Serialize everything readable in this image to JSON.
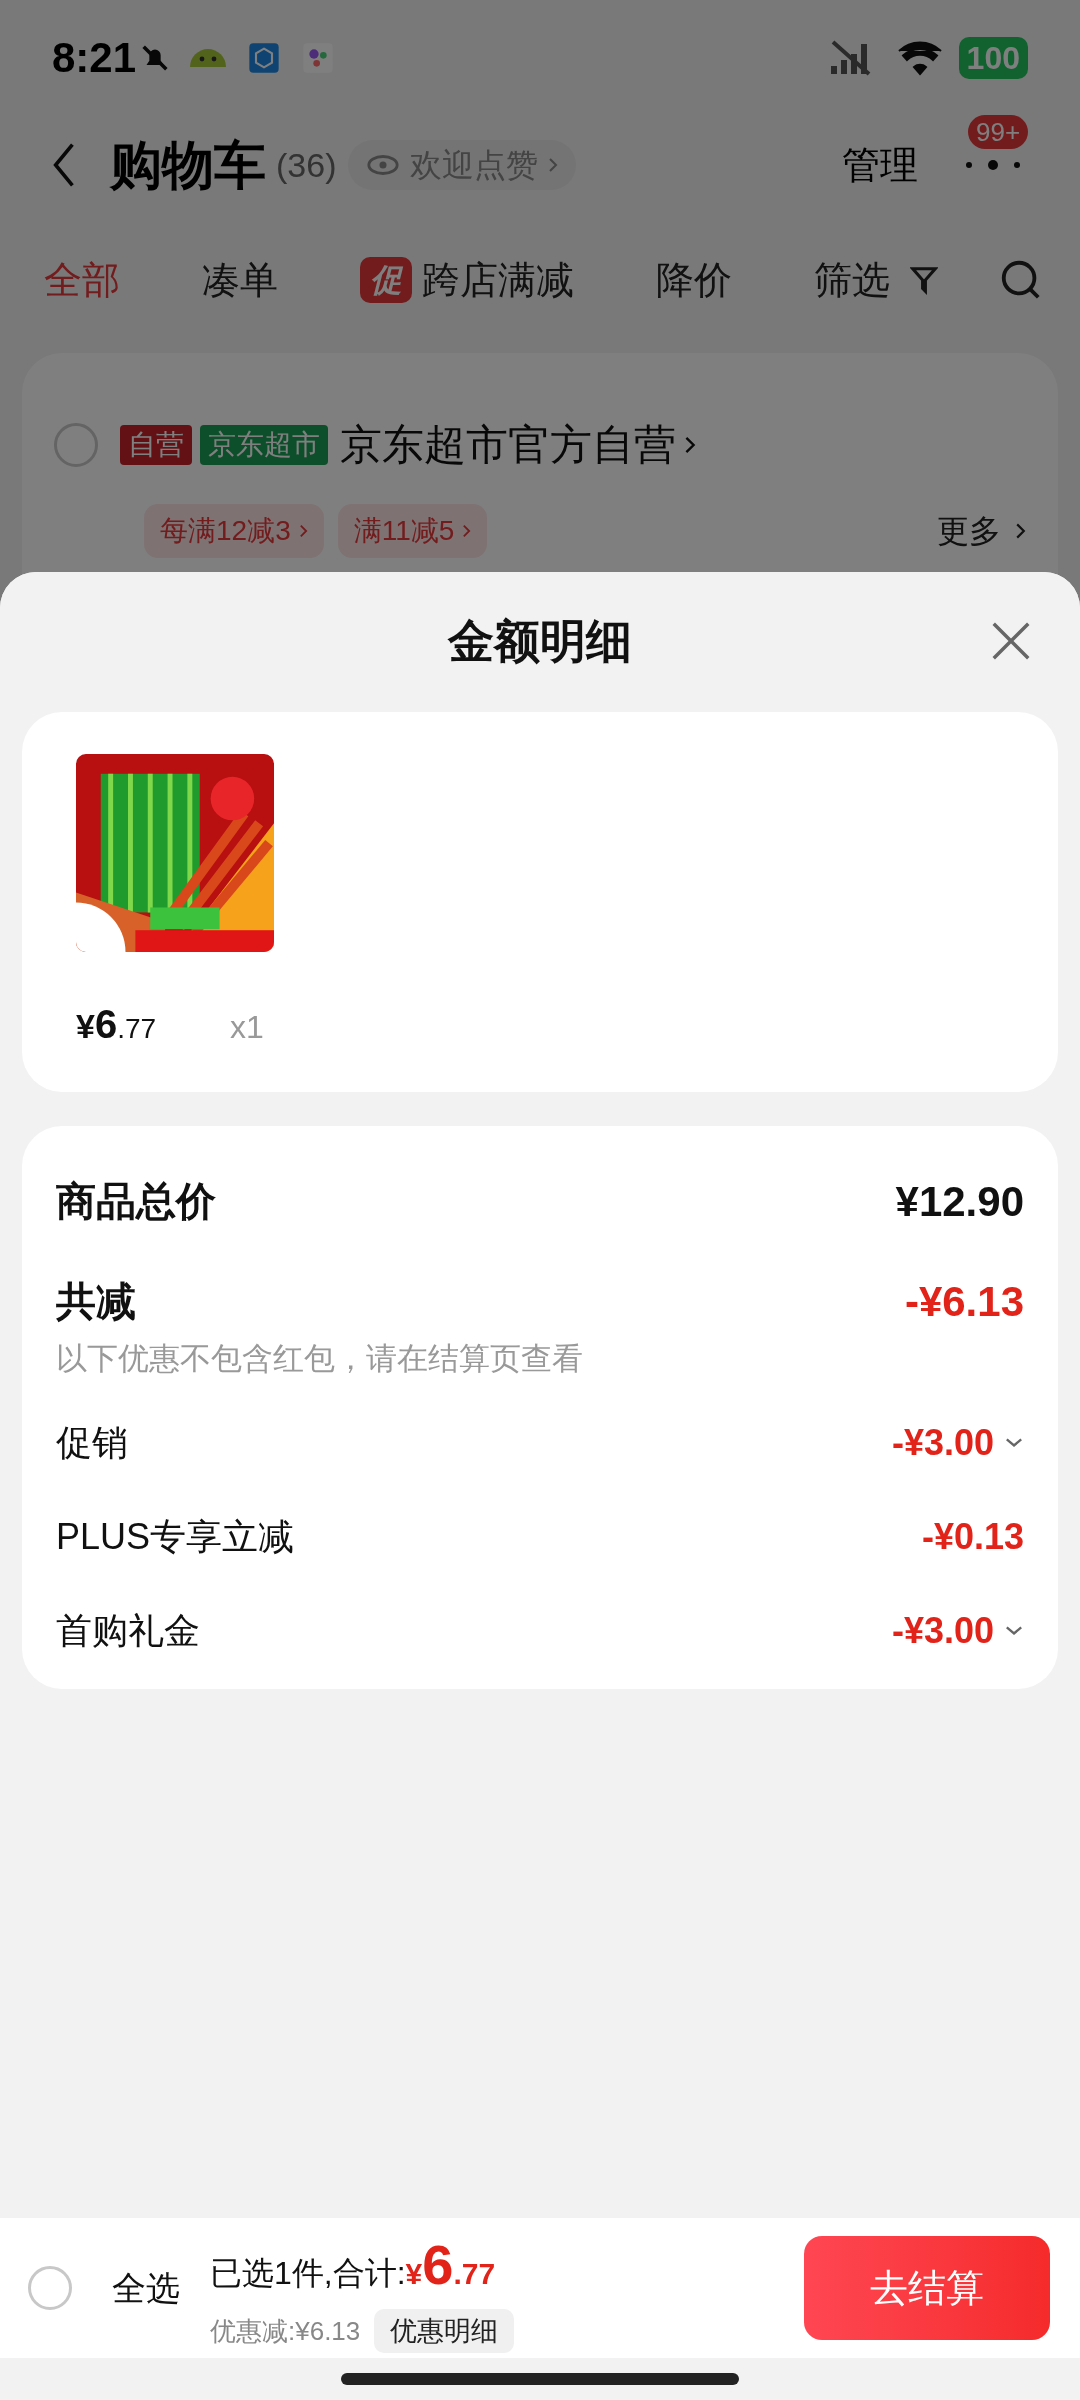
{
  "status_bar": {
    "time": "8:21",
    "battery": "100"
  },
  "header": {
    "title": "购物车",
    "count": "(36)",
    "like_chip": "欢迎点赞",
    "manage": "管理",
    "badge": "99+"
  },
  "tabs": [
    {
      "kind": "plain",
      "label": "全部",
      "selected": true
    },
    {
      "kind": "plain",
      "label": "凑单",
      "selected": false
    },
    {
      "kind": "promo",
      "tag": "促",
      "label": "跨店满减",
      "selected": false
    },
    {
      "kind": "plain",
      "label": "降价",
      "selected": false
    },
    {
      "kind": "filter",
      "label": "筛选",
      "selected": false
    }
  ],
  "store": {
    "checked": false,
    "tags": [
      {
        "label": "自营",
        "kind": "self_operated"
      },
      {
        "label": "京东超市",
        "kind": "supermarket"
      }
    ],
    "name": "京东超市官方自营",
    "promos": [
      "每满12减3",
      "满11减5"
    ],
    "more": "更多"
  },
  "sheet": {
    "title": "金额明细",
    "product": {
      "kind": "picture",
      "currency": "¥",
      "integer": "6",
      "decimal": ".77",
      "quantity": "x1"
    },
    "total": {
      "label": "商品总价",
      "value": "¥12.90"
    },
    "reduction": {
      "label": "共减",
      "value": "-¥6.13",
      "note": "以下优惠不包含红包，请在结算页查看"
    },
    "items": [
      {
        "label": "促销",
        "value": "-¥3.00",
        "expandable": true
      },
      {
        "label": "PLUS专享立减",
        "value": "-¥0.13",
        "expandable": false
      },
      {
        "label": "首购礼金",
        "value": "-¥3.00",
        "expandable": true
      }
    ]
  },
  "bottom_bar": {
    "select_all": {
      "label": "全选",
      "checked": false
    },
    "summary": "已选1件,合计:",
    "currency": "¥",
    "integer": "6",
    "decimal": ".77",
    "discount": "优惠减:¥6.13",
    "detail_button": "优惠明细",
    "checkout": "去结算"
  }
}
